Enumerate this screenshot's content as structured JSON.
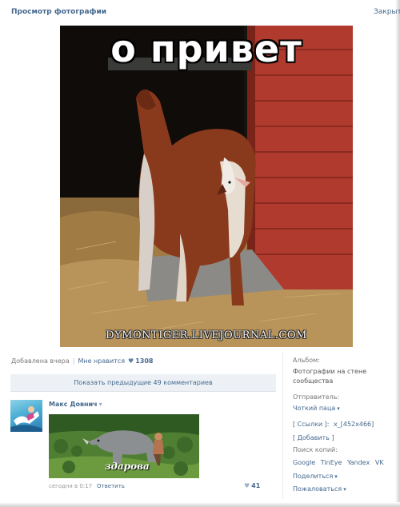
{
  "header": {
    "title": "Просмотр фотографии",
    "close_label": "Закрыть"
  },
  "photo": {
    "caption": "о привет",
    "watermark": "DYMONTIGER.LIVEJOURNAL.COM"
  },
  "meta": {
    "added": "Добавлена вчера",
    "likes_label": "Мне нравится",
    "likes_count": "1308"
  },
  "comments": {
    "show_previous": "Показать предыдущие 49 комментариев",
    "items": [
      {
        "author": "Макс Довнич",
        "image_text": "здарова",
        "date": "сегодня в 0:17",
        "reply": "Ответить",
        "likes": "41"
      }
    ]
  },
  "sidebar": {
    "album_label": "Альбом:",
    "album_value": "Фотографии на стене сообщества",
    "sender_label": "Отправитель:",
    "sender_value": "Чоткий паца",
    "links_label": "[ Ссылки ]:",
    "size_link": "x_[452x466]",
    "add_label": "[ Добавить ]",
    "search_copies_label": "Поиск копий:",
    "search_engines": [
      "Google",
      "TinEye",
      "Yandex",
      "VK"
    ],
    "share_label": "Поделиться",
    "report_label": "Пожаловаться"
  },
  "colors": {
    "link": "#45688e",
    "muted": "#777777",
    "panel": "#edf1f5"
  }
}
